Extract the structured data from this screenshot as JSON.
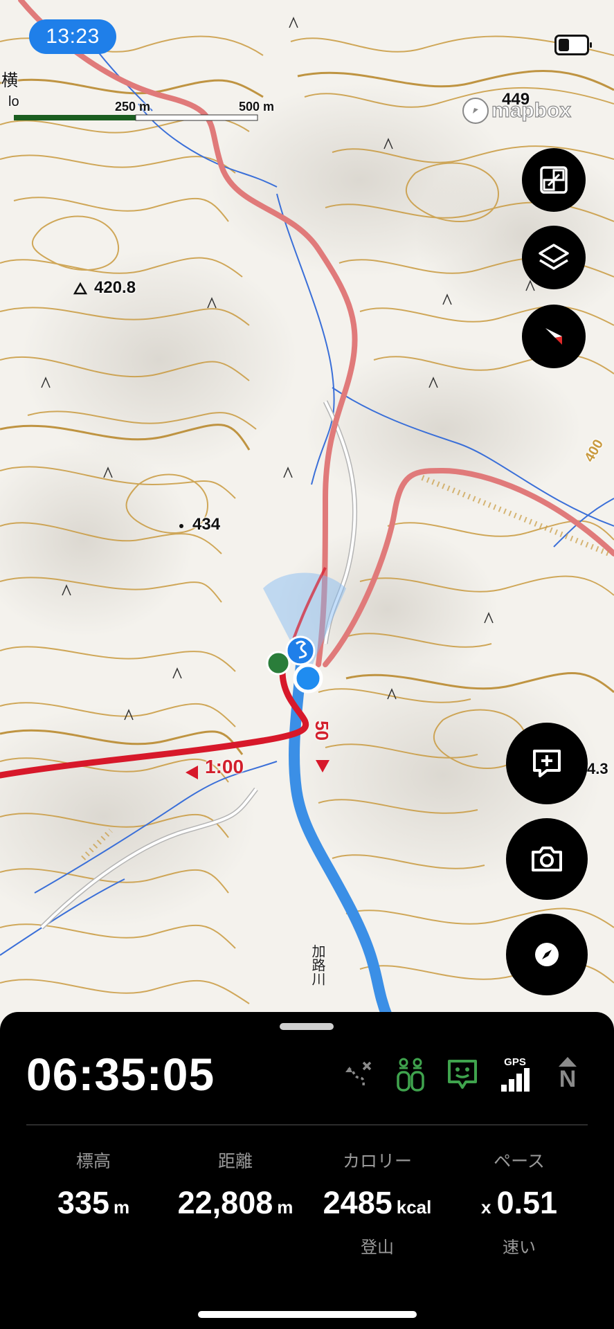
{
  "status_bar": {
    "time": "13:23"
  },
  "map": {
    "scale": {
      "label_250": "250 m",
      "label_500": "500 m"
    },
    "attribution": "mapbox",
    "edge_label": "横",
    "edge_label_2": "lo",
    "peaks": [
      {
        "label": "449"
      },
      {
        "label": "420.8"
      },
      {
        "label": "434"
      },
      {
        "label": "4.3"
      },
      {
        "label": "400"
      }
    ],
    "river_name": "加路川",
    "route_times": {
      "left": "1:00",
      "down": "50"
    }
  },
  "controls": {
    "fit_route": "fit-route-icon",
    "layers": "layers-icon",
    "compass": "compass-north-icon",
    "add_memo": "add-memo-icon",
    "camera": "camera-icon",
    "navigate": "navigation-compass-icon"
  },
  "activity": {
    "elapsed": "06:35:05",
    "gps_label": "GPS",
    "north_label": "N",
    "stats": [
      {
        "label": "標高",
        "value": "335",
        "unit": "m",
        "sub": ""
      },
      {
        "label": "距離",
        "value": "22,808",
        "unit": "m",
        "sub": ""
      },
      {
        "label": "カロリー",
        "value": "2485",
        "unit": "kcal",
        "sub": "登山"
      },
      {
        "label": "ペース",
        "prefix": "x",
        "value": "0.51",
        "unit": "",
        "sub": "速い"
      }
    ]
  },
  "colors": {
    "accent": "#1f7fe9",
    "route": "#d7182a",
    "track": "#3b8fe6",
    "contour": "#c99a3f",
    "road": "#e07a7a",
    "sheet": "#000000",
    "status_green": "#3fa34d"
  }
}
